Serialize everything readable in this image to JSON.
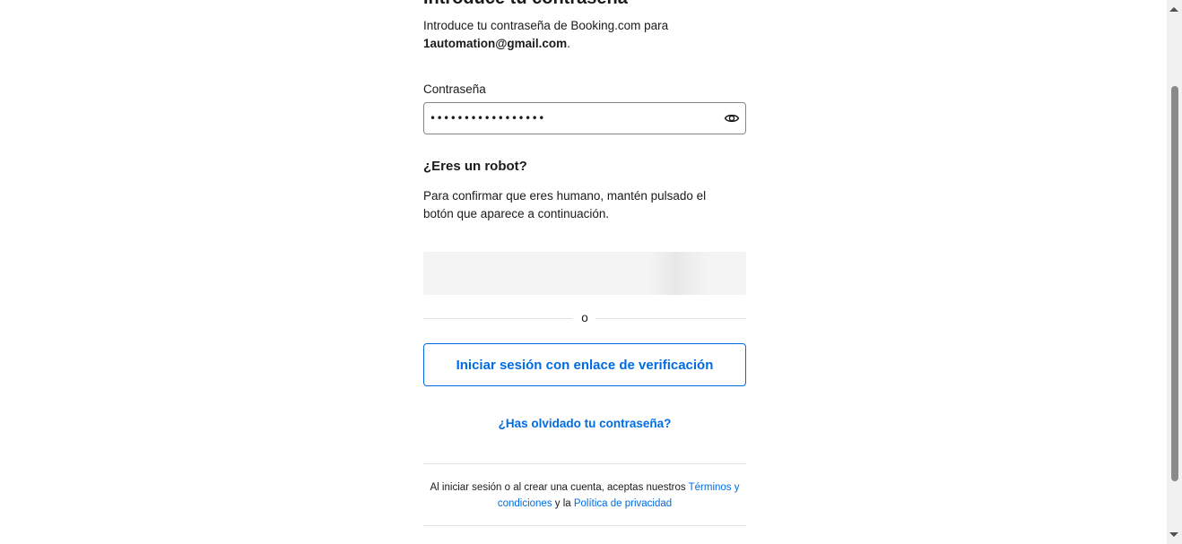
{
  "page": {
    "heading": "Introduce tu contraseña",
    "intro_text": "Introduce tu contraseña de Booking.com para",
    "email": "1automation@gmail.com",
    "intro_end": "."
  },
  "password": {
    "label": "Contraseña",
    "value": "•••••••••••••••••",
    "show_icon": "eye-icon"
  },
  "robot": {
    "title": "¿Eres un robot?",
    "text": "Para confirmar que eres humano, mantén pulsado el botón que aparece a continuación."
  },
  "divider": {
    "label": "o"
  },
  "actions": {
    "verify_link_label": "Iniciar sesión con enlace de verificación",
    "forgot_label": "¿Has olvidado tu contraseña?"
  },
  "legal": {
    "prefix": "Al iniciar sesión o al crear una cuenta, aceptas nuestros ",
    "terms_label": "Términos y condiciones",
    "middle": " y la ",
    "privacy_label": "Política de privacidad"
  },
  "colors": {
    "link": "#006ce4",
    "text": "#1a1a1a",
    "border": "#868686"
  }
}
